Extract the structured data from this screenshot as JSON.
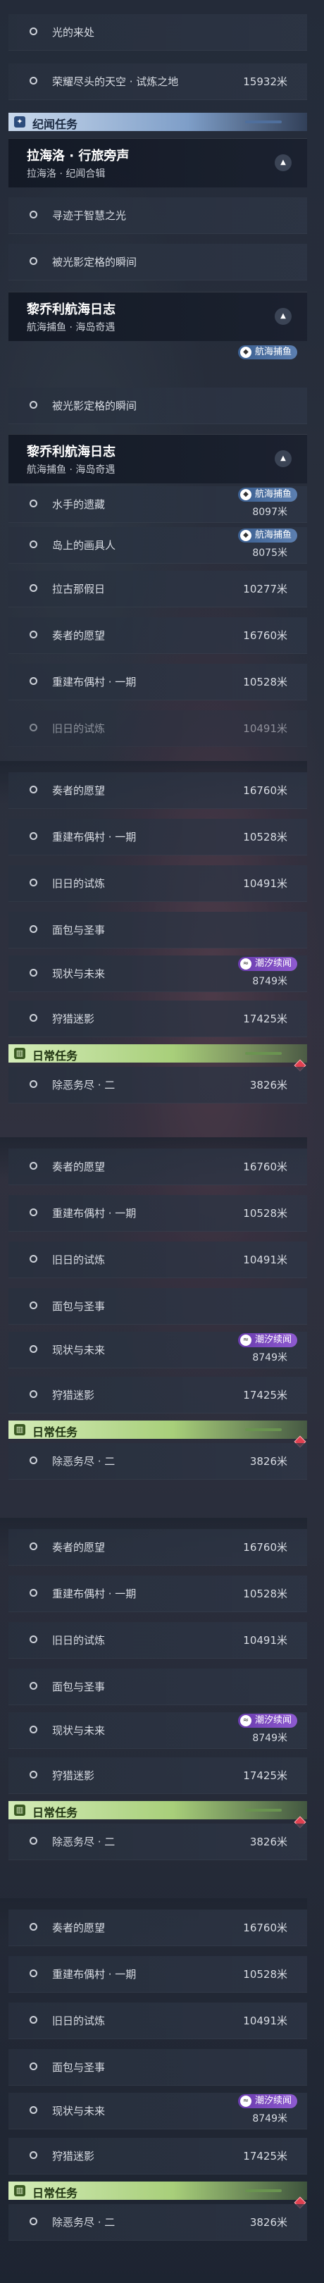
{
  "badges": {
    "fishing": "航海捕鱼",
    "tide": "潮汐续闻"
  },
  "panel1": {
    "items_top": [
      {
        "name": "光的来处",
        "distance": ""
      },
      {
        "name": "荣耀尽头的天空 · 试炼之地",
        "distance": "15932米"
      }
    ],
    "lore_header": "纪闻任务",
    "card1": {
      "title": "拉海洛 · 行旅旁声",
      "subtitle": "拉海洛 · 纪闻合辑"
    },
    "card1_items": [
      {
        "name": "寻迹于智慧之光"
      },
      {
        "name": "被光影定格的瞬间"
      }
    ],
    "card2": {
      "title": "黎乔利航海日志",
      "subtitle": "航海捕鱼 · 海岛奇遇"
    }
  },
  "panel2": {
    "item_top": {
      "name": "被光影定格的瞬间"
    },
    "card": {
      "title": "黎乔利航海日志",
      "subtitle": "航海捕鱼 · 海岛奇遇"
    },
    "items": [
      {
        "name": "水手的遗藏",
        "distance": "8097米"
      },
      {
        "name": "岛上的画具人",
        "distance": "8075米"
      },
      {
        "name": "拉古那假日",
        "distance": "10277米"
      },
      {
        "name": "奏者的愿望",
        "distance": "16760米"
      },
      {
        "name": "重建布偶村 · 一期",
        "distance": "10528米"
      },
      {
        "name": "旧日的试炼",
        "distance": "10491米"
      }
    ]
  },
  "daily_list": {
    "items": [
      {
        "name": "奏者的愿望",
        "distance": "16760米"
      },
      {
        "name": "重建布偶村 · 一期",
        "distance": "10528米"
      },
      {
        "name": "旧日的试炼",
        "distance": "10491米"
      },
      {
        "name": "面包与圣事",
        "distance": ""
      },
      {
        "name": "现状与未来",
        "distance": "8749米"
      },
      {
        "name": "狩猎迷影",
        "distance": "17425米"
      }
    ],
    "daily_header": "日常任务",
    "daily_item": {
      "name": "除恶务尽 · 二",
      "distance": "3826米"
    }
  },
  "colors": {
    "accent_lore": "#7e9ec8",
    "accent_daily": "#a8cf7a",
    "tide_badge": "#8e5ad0",
    "fish_badge": "#5c7fb0"
  }
}
